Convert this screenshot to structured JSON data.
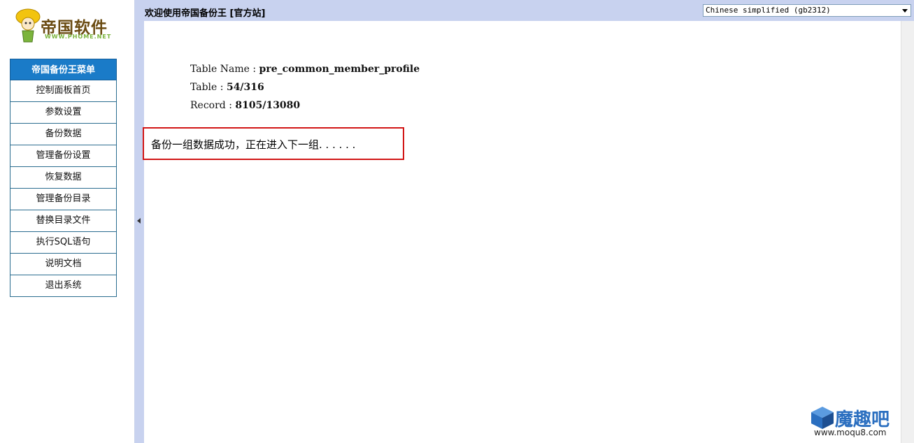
{
  "header": {
    "title": "欢迎使用帝国备份王 [官方站]"
  },
  "language_select": {
    "selected": "Chinese simplified (gb2312)"
  },
  "logo": {
    "brand_text": "帝国软件",
    "url_text": "WWW.PHOME.NET"
  },
  "menu": {
    "title": "帝国备份王菜单",
    "items": [
      {
        "label": "控制面板首页"
      },
      {
        "label": "参数设置"
      },
      {
        "label": "备份数据"
      },
      {
        "label": "管理备份设置"
      },
      {
        "label": "恢复数据"
      },
      {
        "label": "管理备份目录"
      },
      {
        "label": "替换目录文件"
      },
      {
        "label": "执行SQL语句"
      },
      {
        "label": "说明文档"
      },
      {
        "label": "退出系统"
      }
    ]
  },
  "progress": {
    "table_name_label": "Table Name : ",
    "table_name_value": "pre_common_member_profile",
    "table_label": "Table : ",
    "table_value": "54/316",
    "record_label": "Record : ",
    "record_value": "8105/13080"
  },
  "message": {
    "text": "备份一组数据成功，正在进入下一组. . . . . ."
  },
  "watermark": {
    "brand": "魔趣吧",
    "url": "www.moqu8.com"
  },
  "colors": {
    "menu_title_bg": "#1a7bc8",
    "topbar_bg": "#c8d2ef",
    "highlight_border": "#d21616"
  }
}
